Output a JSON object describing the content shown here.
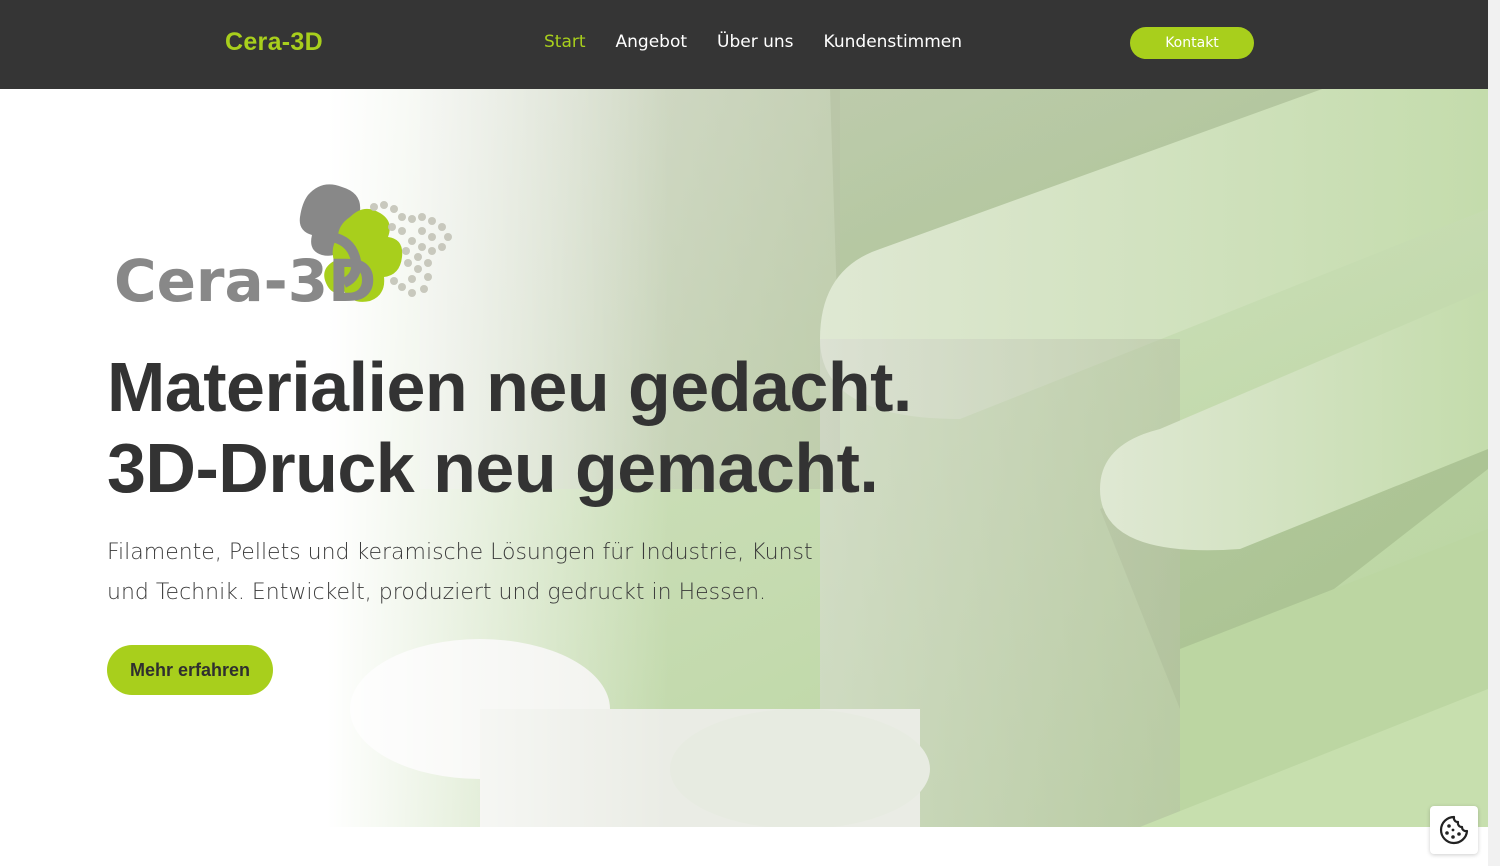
{
  "header": {
    "brand": "Cera-3D",
    "nav": [
      {
        "label": "Start",
        "active": true
      },
      {
        "label": "Angebot",
        "active": false
      },
      {
        "label": "Über uns",
        "active": false
      },
      {
        "label": "Kundenstimmen",
        "active": false
      }
    ],
    "contact_label": "Kontakt"
  },
  "hero": {
    "logo_text": "Cera-3D",
    "headline_line1": "Materialien neu gedacht.",
    "headline_line2": "3D-Druck neu gemacht.",
    "subtext_line1": "Filamente, Pellets und keramische Lösungen für Industrie, Kunst",
    "subtext_line2": "und Technik. Entwickelt, produziert und gedruckt in Hessen.",
    "cta_label": "Mehr erfahren"
  },
  "cookie": {
    "icon": "cookie-icon"
  },
  "colors": {
    "accent": "#a8cf1c",
    "header_bg": "#353535",
    "text_dark": "#333333"
  }
}
